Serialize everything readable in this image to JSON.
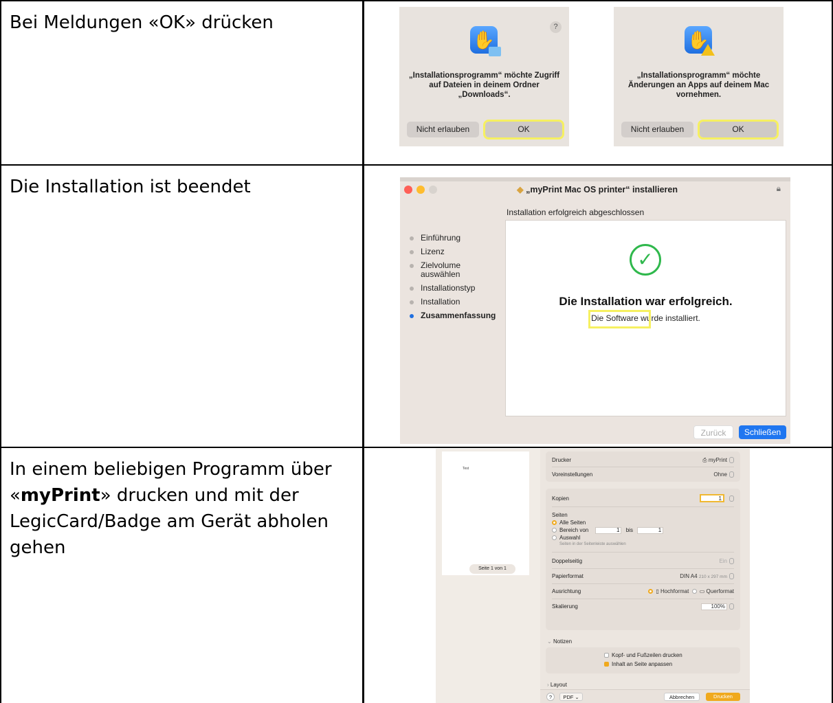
{
  "rows": [
    {
      "text": "Bei Meldungen «OK» drücken"
    },
    {
      "text": "Die Installation ist beendet"
    },
    {
      "text_before": "In einem beliebigen Programm über «",
      "text_bold": "myPrint",
      "text_after": "» drucken und mit der LegicCard/Badge am Gerät abholen gehen"
    }
  ],
  "dialogs": [
    {
      "message": "„Installationsprogramm“ möchte Zugriff auf Dateien in deinem Ordner „Downloads“.",
      "deny_label": "Nicht erlauben",
      "ok_label": "OK",
      "help": "?"
    },
    {
      "message": "„Installationsprogramm“ möchte Änderungen an Apps auf deinem Mac vornehmen.",
      "deny_label": "Nicht erlauben",
      "ok_label": "OK"
    }
  ],
  "installer": {
    "window_title": "„myPrint Mac OS printer“ installieren",
    "subtitle": "Installation erfolgreich abgeschlossen",
    "steps": [
      "Einführung",
      "Lizenz",
      "Zielvolume auswählen",
      "Installationstyp",
      "Installation",
      "Zusammenfassung"
    ],
    "active_step": "Zusammenfassung",
    "success_title": "Die Installation war erfolgreich.",
    "success_text": "Die Software wurde installiert.",
    "back_label": "Zurück",
    "close_label": "Schließen",
    "accent": "#1f76f0"
  },
  "print": {
    "preview_text": "Test",
    "page_indicator": "Seite 1 von 1",
    "printer_label": "Drucker",
    "printer_value": "myPrint",
    "presets_label": "Voreinstellungen",
    "presets_value": "Ohne",
    "copies_label": "Kopien",
    "copies_value": "1",
    "pages_label": "Seiten",
    "all_pages": "Alle Seiten",
    "range_label": "Bereich von",
    "range_from": "1",
    "range_to_label": "bis",
    "range_to": "1",
    "selection_label": "Auswahl",
    "selection_hint": "Seiten in der Seitenleiste auswählen",
    "duplex_label": "Doppelseitig",
    "duplex_value": "Ein",
    "paper_label": "Papierformat",
    "paper_value": "DIN A4",
    "paper_size": "210 x 297 mm",
    "orientation_label": "Ausrichtung",
    "portrait": "Hochformat",
    "landscape": "Querformat",
    "scale_label": "Skalierung",
    "scale_value": "100%",
    "notes_label": "Notizen",
    "header_footer": "Kopf- und Fußzeilen drucken",
    "fit_page": "Inhalt an Seite anpassen",
    "layout_label": "Layout",
    "help": "?",
    "pdf_label": "PDF",
    "cancel_label": "Abbrechen",
    "print_label": "Drucken",
    "accent": "#f0a91d"
  }
}
